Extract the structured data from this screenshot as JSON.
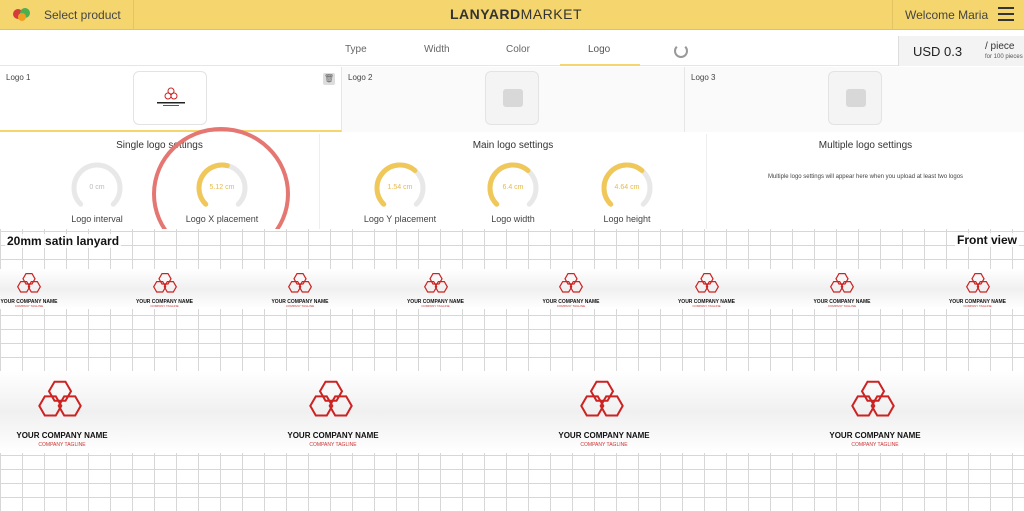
{
  "header": {
    "select_product": "Select product",
    "brand_bold": "LANYARD",
    "brand_light": "MARKET",
    "welcome": "Welcome Maria"
  },
  "tabs": [
    "Type",
    "Width",
    "Color",
    "Logo"
  ],
  "price": {
    "amount": "USD 0.3",
    "per": "/ piece",
    "note": "for 100 pieces"
  },
  "logo_slots": [
    {
      "label": "Logo 1"
    },
    {
      "label": "Logo 2"
    },
    {
      "label": "Logo 3"
    }
  ],
  "panels": {
    "single": {
      "title": "Single logo settings",
      "gauges": [
        {
          "value": "0 cm",
          "label": "Logo interval",
          "fill": 0
        },
        {
          "value": "5.12 cm",
          "label": "Logo X placement",
          "fill": 0.55
        }
      ]
    },
    "main": {
      "title": "Main logo settings",
      "gauges": [
        {
          "value": "1.54 cm",
          "label": "Logo Y placement",
          "fill": 0.65
        },
        {
          "value": "6.4 cm",
          "label": "Logo width",
          "fill": 0.65
        },
        {
          "value": "4.64 cm",
          "label": "Logo height",
          "fill": 0.65
        }
      ]
    },
    "multiple": {
      "title": "Multiple logo settings",
      "note": "Multiple logo settings will appear here when you upload at least two logos"
    }
  },
  "preview": {
    "title": "20mm satin lanyard",
    "view": "Front view",
    "company_name": "YOUR COMPANY NAME",
    "tagline": "COMPANY TAGLINE"
  },
  "colors": {
    "accent": "#f5d66e",
    "gauge": "#f0c85a",
    "highlight": "#e57773",
    "logo_red": "#cc2222"
  }
}
